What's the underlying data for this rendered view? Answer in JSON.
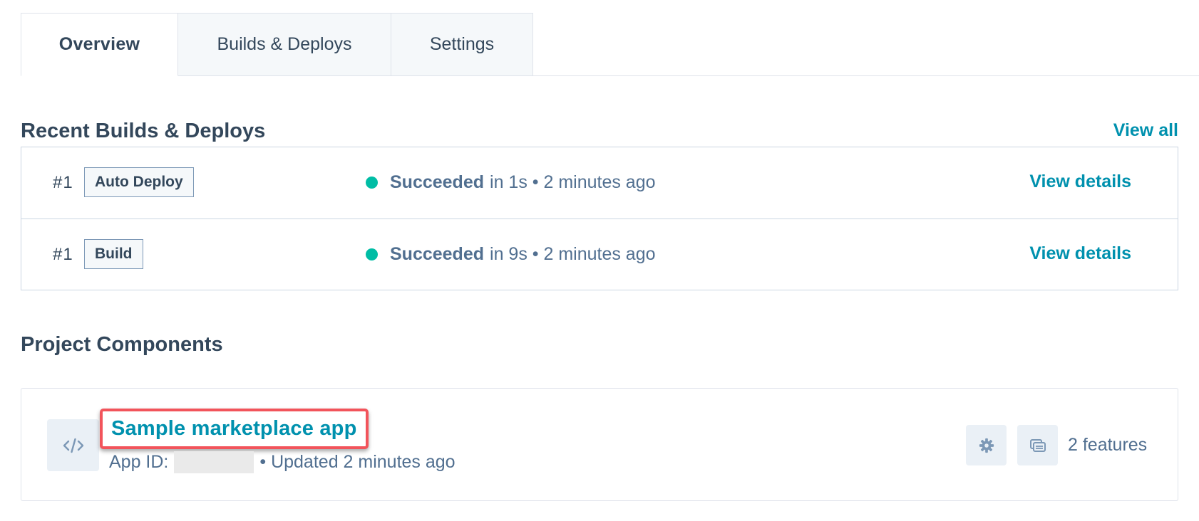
{
  "tabs": [
    {
      "label": "Overview",
      "active": true
    },
    {
      "label": "Builds & Deploys",
      "active": false
    },
    {
      "label": "Settings",
      "active": false
    }
  ],
  "recent": {
    "title": "Recent Builds & Deploys",
    "view_all_label": "View all",
    "rows": [
      {
        "number": "#1",
        "tag": "Auto Deploy",
        "status": "Succeeded",
        "detail": "in 1s • 2 minutes ago",
        "action": "View details"
      },
      {
        "number": "#1",
        "tag": "Build",
        "status": "Succeeded",
        "detail": "in 9s • 2 minutes ago",
        "action": "View details"
      }
    ]
  },
  "components": {
    "title": "Project Components",
    "card": {
      "icon": "code-icon",
      "name": "Sample marketplace app",
      "app_id_label": "App ID:",
      "updated": "• Updated 2 minutes ago",
      "settings_icon": "gear-icon",
      "features_icon": "stacked-cards-icon",
      "features": "2 features"
    }
  },
  "colors": {
    "link": "#0091ae",
    "success": "#00bda5",
    "highlight": "#f2545b",
    "text": "#33475b"
  }
}
